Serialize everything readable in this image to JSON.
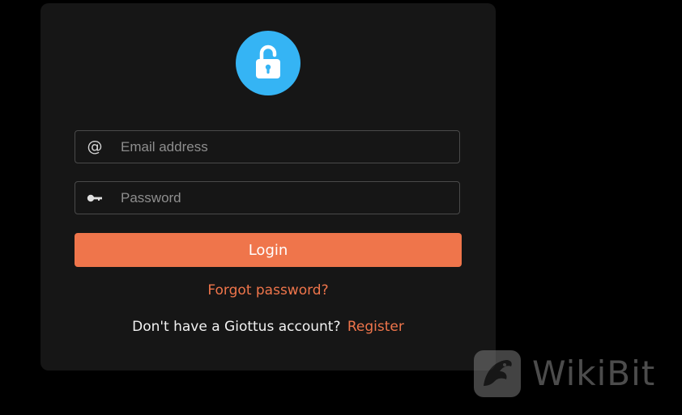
{
  "login_card": {
    "icon": "lock-icon",
    "email": {
      "icon": "at-icon",
      "placeholder": "Email address",
      "value": ""
    },
    "password": {
      "icon": "key-icon",
      "placeholder": "Password",
      "value": ""
    },
    "login_label": "Login",
    "forgot_label": "Forgot password?",
    "register_prompt": "Don't have a Giottus account?",
    "register_label": "Register"
  },
  "watermark": {
    "text": "WikiBit",
    "icon": "wikibit-logo-icon"
  },
  "colors": {
    "background": "#000000",
    "card": "#161616",
    "accent": "#ef754b",
    "lock_circle": "#35b4f4"
  }
}
